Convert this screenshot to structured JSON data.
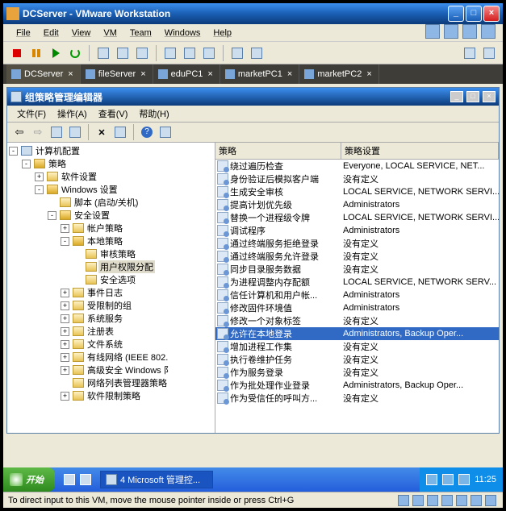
{
  "window": {
    "title": "DCServer - VMware Workstation"
  },
  "menu": {
    "file": "File",
    "edit": "Edit",
    "view": "View",
    "vm": "VM",
    "team": "Team",
    "windows": "Windows",
    "help": "Help"
  },
  "tabs": [
    {
      "label": "DCServer",
      "active": true
    },
    {
      "label": "fileServer",
      "active": false
    },
    {
      "label": "eduPC1",
      "active": false
    },
    {
      "label": "marketPC1",
      "active": false
    },
    {
      "label": "marketPC2",
      "active": false
    }
  ],
  "gpo": {
    "title": "组策略管理编辑器",
    "menu": {
      "file": "文件(F)",
      "action": "操作(A)",
      "view": "查看(V)",
      "help": "帮助(H)"
    },
    "tree": {
      "root": "计算机配置",
      "policy": "策略",
      "soft": "软件设置",
      "winset": "Windows 设置",
      "script": "脚本 (启动/关机)",
      "sec": "安全设置",
      "acct": "帐户策略",
      "local": "本地策略",
      "audit": "审核策略",
      "ura": "用户权限分配",
      "secopt": "安全选项",
      "elog": "事件日志",
      "rgrp": "受限制的组",
      "svc": "系统服务",
      "reg": "注册表",
      "fs": "文件系统",
      "wlan": "有线网络 (IEEE 802.",
      "advsec": "高级安全 Windows 阝",
      "nlist": "网络列表管理器策略",
      "softrest": "软件限制策略"
    },
    "columns": {
      "name": "策略",
      "setting": "策略设置"
    },
    "rows": [
      {
        "name": "绕过遍历检查",
        "val": "Everyone, LOCAL SERVICE, NET..."
      },
      {
        "name": "身份验证后模拟客户端",
        "val": "没有定义"
      },
      {
        "name": "生成安全审核",
        "val": "LOCAL SERVICE, NETWORK SERVI..."
      },
      {
        "name": "提高计划优先级",
        "val": "Administrators"
      },
      {
        "name": "替换一个进程级令牌",
        "val": "LOCAL SERVICE, NETWORK SERVI..."
      },
      {
        "name": "调试程序",
        "val": "Administrators"
      },
      {
        "name": "通过终端服务拒绝登录",
        "val": "没有定义"
      },
      {
        "name": "通过终端服务允许登录",
        "val": "没有定义"
      },
      {
        "name": "同步目录服务数据",
        "val": "没有定义"
      },
      {
        "name": "为进程调整内存配额",
        "val": "LOCAL SERVICE, NETWORK SERV..."
      },
      {
        "name": "信任计算机和用户帐...",
        "val": "Administrators"
      },
      {
        "name": "修改固件环境值",
        "val": "Administrators"
      },
      {
        "name": "修改一个对象标签",
        "val": "没有定义"
      },
      {
        "name": "允许在本地登录",
        "val": "Administrators, Backup Oper...",
        "selected": true
      },
      {
        "name": "增加进程工作集",
        "val": "没有定义"
      },
      {
        "name": "执行卷维护任务",
        "val": "没有定义"
      },
      {
        "name": "作为服务登录",
        "val": "没有定义"
      },
      {
        "name": "作为批处理作业登录",
        "val": "Administrators, Backup Oper..."
      },
      {
        "name": "作为受信任的呼叫方...",
        "val": "没有定义"
      }
    ]
  },
  "taskbar": {
    "start": "开始",
    "task": "4 Microsoft 管理控...",
    "time": "11:25"
  },
  "status": "To direct input to this VM, move the mouse pointer inside or press Ctrl+G"
}
